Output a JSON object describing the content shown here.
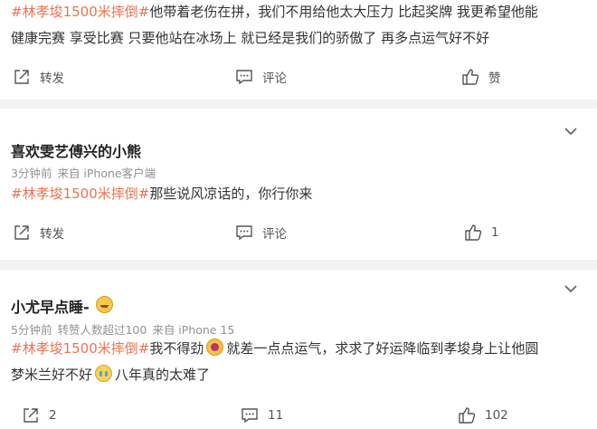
{
  "comments": [
    {
      "hashtag": "#林孝埈1500米摔倒#",
      "line1_text": "他带着老伤在拼，我们不用给他太大压力 比起奖牌 我更希望他能",
      "line2_text": "健康完赛 享受比赛 只要他站在冰场上 就已经是我们的骄傲了 再多点运气好不好",
      "actions": {
        "share": "转发",
        "comment": "评论",
        "like": "赞"
      }
    },
    {
      "username": "喜欢雯艺傅兴的小熊",
      "time": "3分钟前",
      "source": "来自 iPhone客户端",
      "hashtag": "#林孝埈1500米摔倒#",
      "text": "那些说风凉话的，你行你来",
      "actions": {
        "share": "转发",
        "comment": "评论",
        "like": "1"
      }
    },
    {
      "username": "小尤早点睡-",
      "time": "5分钟前",
      "reposts": "转赞人数超过100",
      "source": "来自 iPhone 15",
      "hashtag": "#林孝埈1500米摔倒#",
      "line1_a": "我不得劲",
      "line1_b": "就差一点点运气，求求了好运降临到孝埈身上让他圆",
      "line2_a": "梦米兰好不好",
      "line2_b": "八年真的太难了",
      "actions": {
        "share": "2",
        "comment": "11",
        "like": "102"
      }
    }
  ],
  "icons": {
    "share": "share-arrow-icon",
    "comment": "comment-bubble-icon",
    "like": "thumbs-up-icon",
    "more": "chevron-down-icon"
  },
  "colors": {
    "hashtag": "#eb7350",
    "meta": "#939393",
    "background": "#f2f2f2"
  }
}
